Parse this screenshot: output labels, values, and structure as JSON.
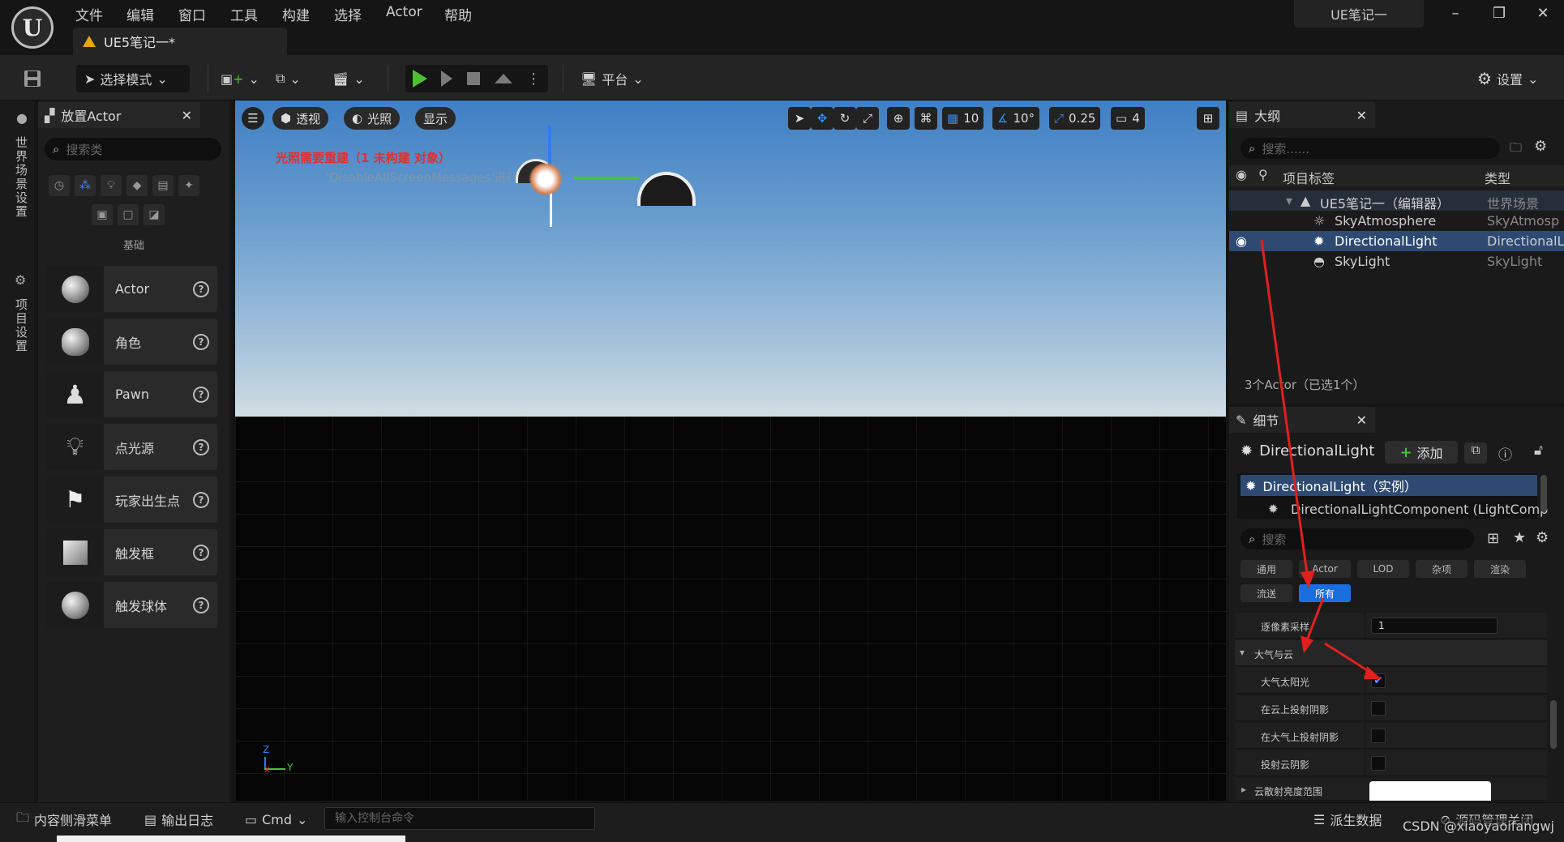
{
  "titlebar": {
    "menu": [
      "文件",
      "编辑",
      "窗口",
      "工具",
      "构建",
      "选择",
      "Actor",
      "帮助"
    ],
    "doc_tab": "UE5笔记一*",
    "project_name": "UE笔记一",
    "window_controls": {
      "minimize": "–",
      "restore": "❐",
      "close": "✕"
    }
  },
  "toolbar": {
    "mode": "选择模式",
    "platform": "平台",
    "settings": "设置"
  },
  "side_strip": {
    "world_settings": "世界场景设置",
    "project_settings": "项目设置"
  },
  "place_actor": {
    "tab_title": "放置Actor",
    "search_placeholder": "搜索类",
    "category_label": "基础",
    "items": [
      {
        "label": "Actor"
      },
      {
        "label": "角色"
      },
      {
        "label": "Pawn"
      },
      {
        "label": "点光源"
      },
      {
        "label": "玩家出生点"
      },
      {
        "label": "触发框"
      },
      {
        "label": "触发球体"
      }
    ]
  },
  "viewport": {
    "view_mode": "透视",
    "lighting": "光照",
    "show": "显示",
    "grid_snap": "10",
    "rot_snap": "10°",
    "scale_snap": "0.25",
    "camera_speed": "4",
    "warning": "光照需要重建（1 未构建 对象）",
    "hint": "'DisableAllScreenMessages'进行抑制",
    "axis_z": "Z",
    "axis_y": "Y"
  },
  "outliner": {
    "tab_title": "大纲",
    "search_placeholder": "搜索......",
    "col_label": "项目标签",
    "col_type": "类型",
    "rows": [
      {
        "label": "UE5笔记一（编辑器）",
        "type": "世界场景"
      },
      {
        "label": "SkyAtmosphere",
        "type": "SkyAtmosp"
      },
      {
        "label": "DirectionalLight",
        "type": "DirectionalL"
      },
      {
        "label": "SkyLight",
        "type": "SkyLight"
      }
    ],
    "status": "3个Actor（已选1个）"
  },
  "details": {
    "tab_title": "细节",
    "actor_name": "DirectionalLight",
    "add_label": "添加",
    "comp_root": "DirectionalLight（实例）",
    "comp_child": "DirectionalLightComponent (LightComp",
    "search_placeholder": "搜索",
    "filters_row1": [
      "通用",
      "Actor",
      "LOD",
      "杂项",
      "渲染"
    ],
    "filters_row2": [
      "流送",
      "所有"
    ],
    "props": {
      "per_pixel_label": "逐像素采样",
      "per_pixel_value": "1",
      "section_label": "大气与云",
      "atmo_sun_label": "大气太阳光",
      "atmo_sun_checked": true,
      "cloud_shadow_label": "在云上投射阴影",
      "atmo_shadow_label": "在大气上投射阴影",
      "cast_cloud_label": "投射云阴影",
      "cloud_scatter_label": "云散射亮度范围"
    }
  },
  "bottombar": {
    "content_drawer": "内容侧滑菜单",
    "output_log": "输出日志",
    "cmd": "Cmd",
    "cmd_placeholder": "输入控制台命令",
    "derived_data": "派生数据",
    "source_control": "源码管理关闭",
    "watermark": "CSDN @xiaoyaoifangwj"
  },
  "colors": {
    "accent": "#1a6fe0",
    "play": "#4cc12f",
    "warning": "#e03030",
    "annotation": "#e0201e"
  }
}
